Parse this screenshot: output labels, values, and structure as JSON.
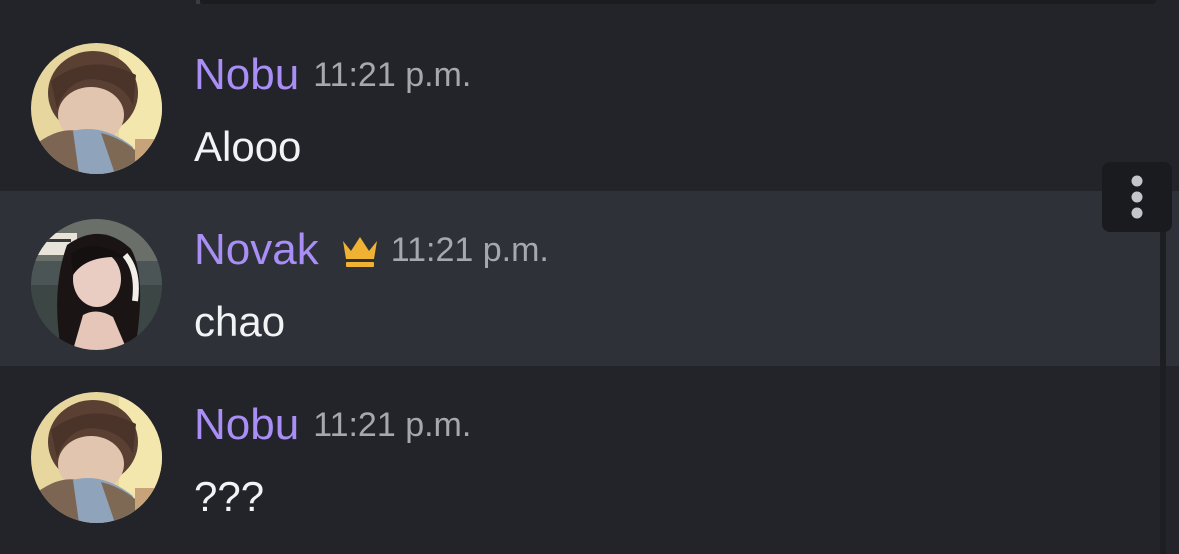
{
  "messages": [
    {
      "author": "Nobu",
      "timestamp": "11:21 p.m.",
      "content": "Alooo",
      "avatar_icon": "nobu-avatar",
      "author_color": "#a88ef5"
    },
    {
      "author": "Novak",
      "timestamp": "11:21 p.m.",
      "content": "chao",
      "avatar_icon": "novak-avatar",
      "badge_icon": "crown-icon",
      "badge_color": "#f0b232",
      "author_color": "#a88ef5"
    },
    {
      "author": "Nobu",
      "timestamp": "11:21 p.m.",
      "content": "???",
      "avatar_icon": "nobu-avatar",
      "author_color": "#a88ef5"
    }
  ],
  "actions": {
    "more_icon": "vertical-ellipsis-icon"
  },
  "theme": {
    "background": "#232429",
    "hover_background": "#2f3138",
    "text": "#f2f3f5",
    "muted": "#a6a8ae"
  }
}
